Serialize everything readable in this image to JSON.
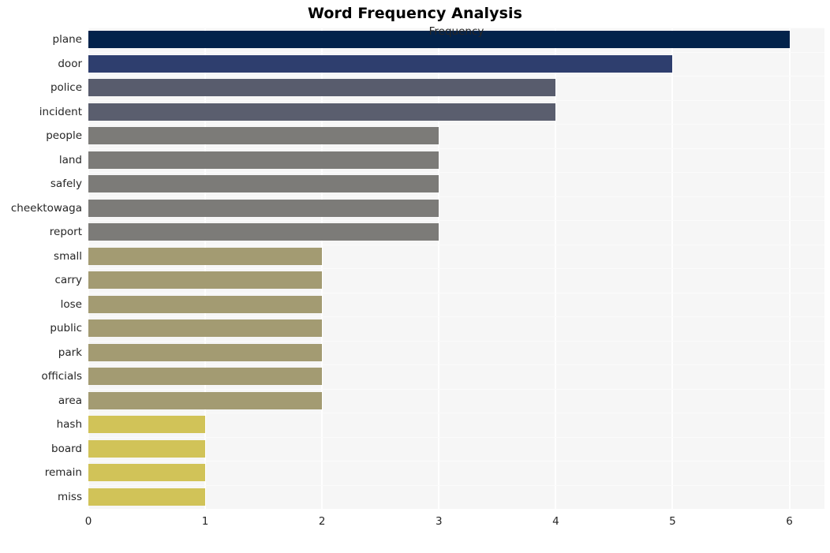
{
  "chart_data": {
    "type": "bar",
    "orientation": "horizontal",
    "title": "Word Frequency Analysis",
    "xlabel": "Frequency",
    "ylabel": "",
    "xlim": [
      0,
      6.3
    ],
    "xticks": [
      "0",
      "1",
      "2",
      "3",
      "4",
      "5",
      "6"
    ],
    "xtick_values": [
      0,
      1,
      2,
      3,
      4,
      5,
      6
    ],
    "grid": true,
    "legend": false,
    "background": "#f6f6f6",
    "gridline_color": "#ffffff",
    "categories": [
      "plane",
      "door",
      "police",
      "incident",
      "people",
      "land",
      "safely",
      "cheektowaga",
      "report",
      "small",
      "carry",
      "lose",
      "public",
      "park",
      "officials",
      "area",
      "hash",
      "board",
      "remain",
      "miss"
    ],
    "values": [
      6,
      5,
      4,
      4,
      3,
      3,
      3,
      3,
      3,
      2,
      2,
      2,
      2,
      2,
      2,
      2,
      1,
      1,
      1,
      1
    ],
    "bar_colors": [
      "#03234b",
      "#2e3e6e",
      "#585c6d",
      "#5a5e6e",
      "#7c7b78",
      "#7c7b78",
      "#7c7b78",
      "#7c7b78",
      "#7c7b78",
      "#a39b72",
      "#a39b72",
      "#a39b72",
      "#a39b72",
      "#a39b72",
      "#a39b72",
      "#a39b72",
      "#d1c358",
      "#d1c358",
      "#d1c358",
      "#d1c358"
    ]
  }
}
